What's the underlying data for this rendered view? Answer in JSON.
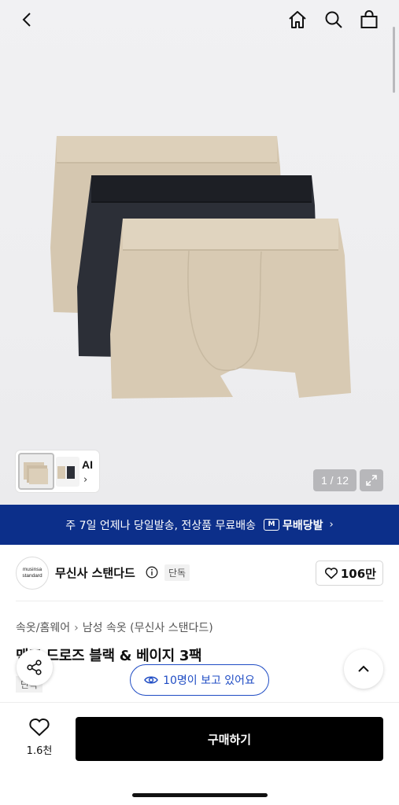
{
  "hero": {
    "counter": "1 / 12",
    "ai_label": "AI"
  },
  "banner": {
    "text": "주 7일 언제나 당일발송, 전상품 무료배송",
    "badge": "M",
    "free_label": "무배당발"
  },
  "brand": {
    "logo_line1": "musinsa",
    "logo_line2": "standard",
    "name": "무신사 스탠다드",
    "tag": "단독",
    "likes": "106만"
  },
  "breadcrumb": {
    "level1": "속옷/홈웨어",
    "level2": "남성 속옷 (무신사 스탠다드)"
  },
  "product": {
    "title": "맨즈 드로즈 블랙 & 베이지 3팩",
    "tag": "단독"
  },
  "viewers": {
    "text": "10명이 보고 있어요"
  },
  "bottom": {
    "wish_count": "1.6천",
    "buy_label": "구매하기"
  },
  "colors": {
    "banner_bg": "#0c2f8a",
    "accent_blue": "#1f4cc4",
    "beige": "#d8cab3",
    "black_item": "#2c2f37"
  }
}
